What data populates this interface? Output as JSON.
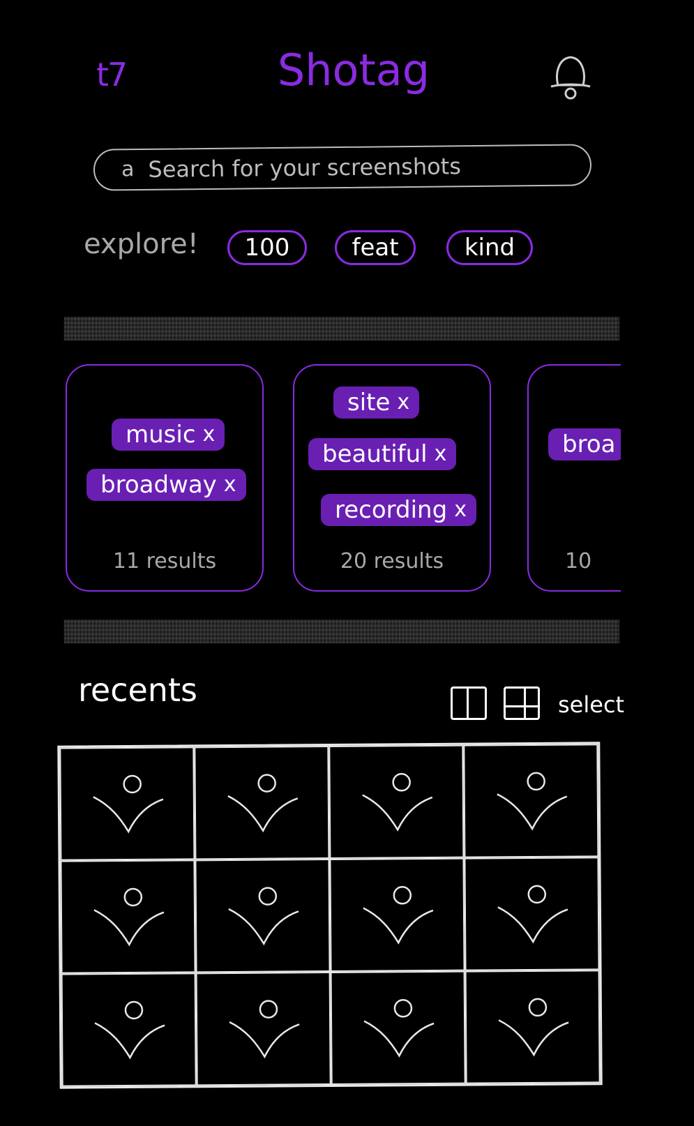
{
  "header": {
    "left_text": "t7",
    "title": "Shotag",
    "bell_icon": "bell-icon"
  },
  "search": {
    "icon": "search-icon",
    "icon_glyph": "a",
    "placeholder": "Search for your screenshots"
  },
  "explore": {
    "label": "explore!",
    "chips": [
      "100",
      "feat",
      "kind"
    ]
  },
  "cards": [
    {
      "tags": [
        "music",
        "broadway"
      ],
      "results": "11 results"
    },
    {
      "tags": [
        "site",
        "beautiful",
        "recording"
      ],
      "results": "20 results"
    },
    {
      "tags": [
        "broa"
      ],
      "results": "10"
    }
  ],
  "tag_remove_glyph": "x",
  "recents": {
    "title": "recents",
    "two_col_icon": "two-column-view-icon",
    "four_col_icon": "grid-view-icon",
    "select_label": "select",
    "thumbnail_icon": "image-placeholder-icon",
    "thumbnail_count": 12
  },
  "colors": {
    "accent": "#8a2be2",
    "tag_fill": "#6a1fb3",
    "background": "#000000",
    "chalk": "#e8e8e8"
  }
}
